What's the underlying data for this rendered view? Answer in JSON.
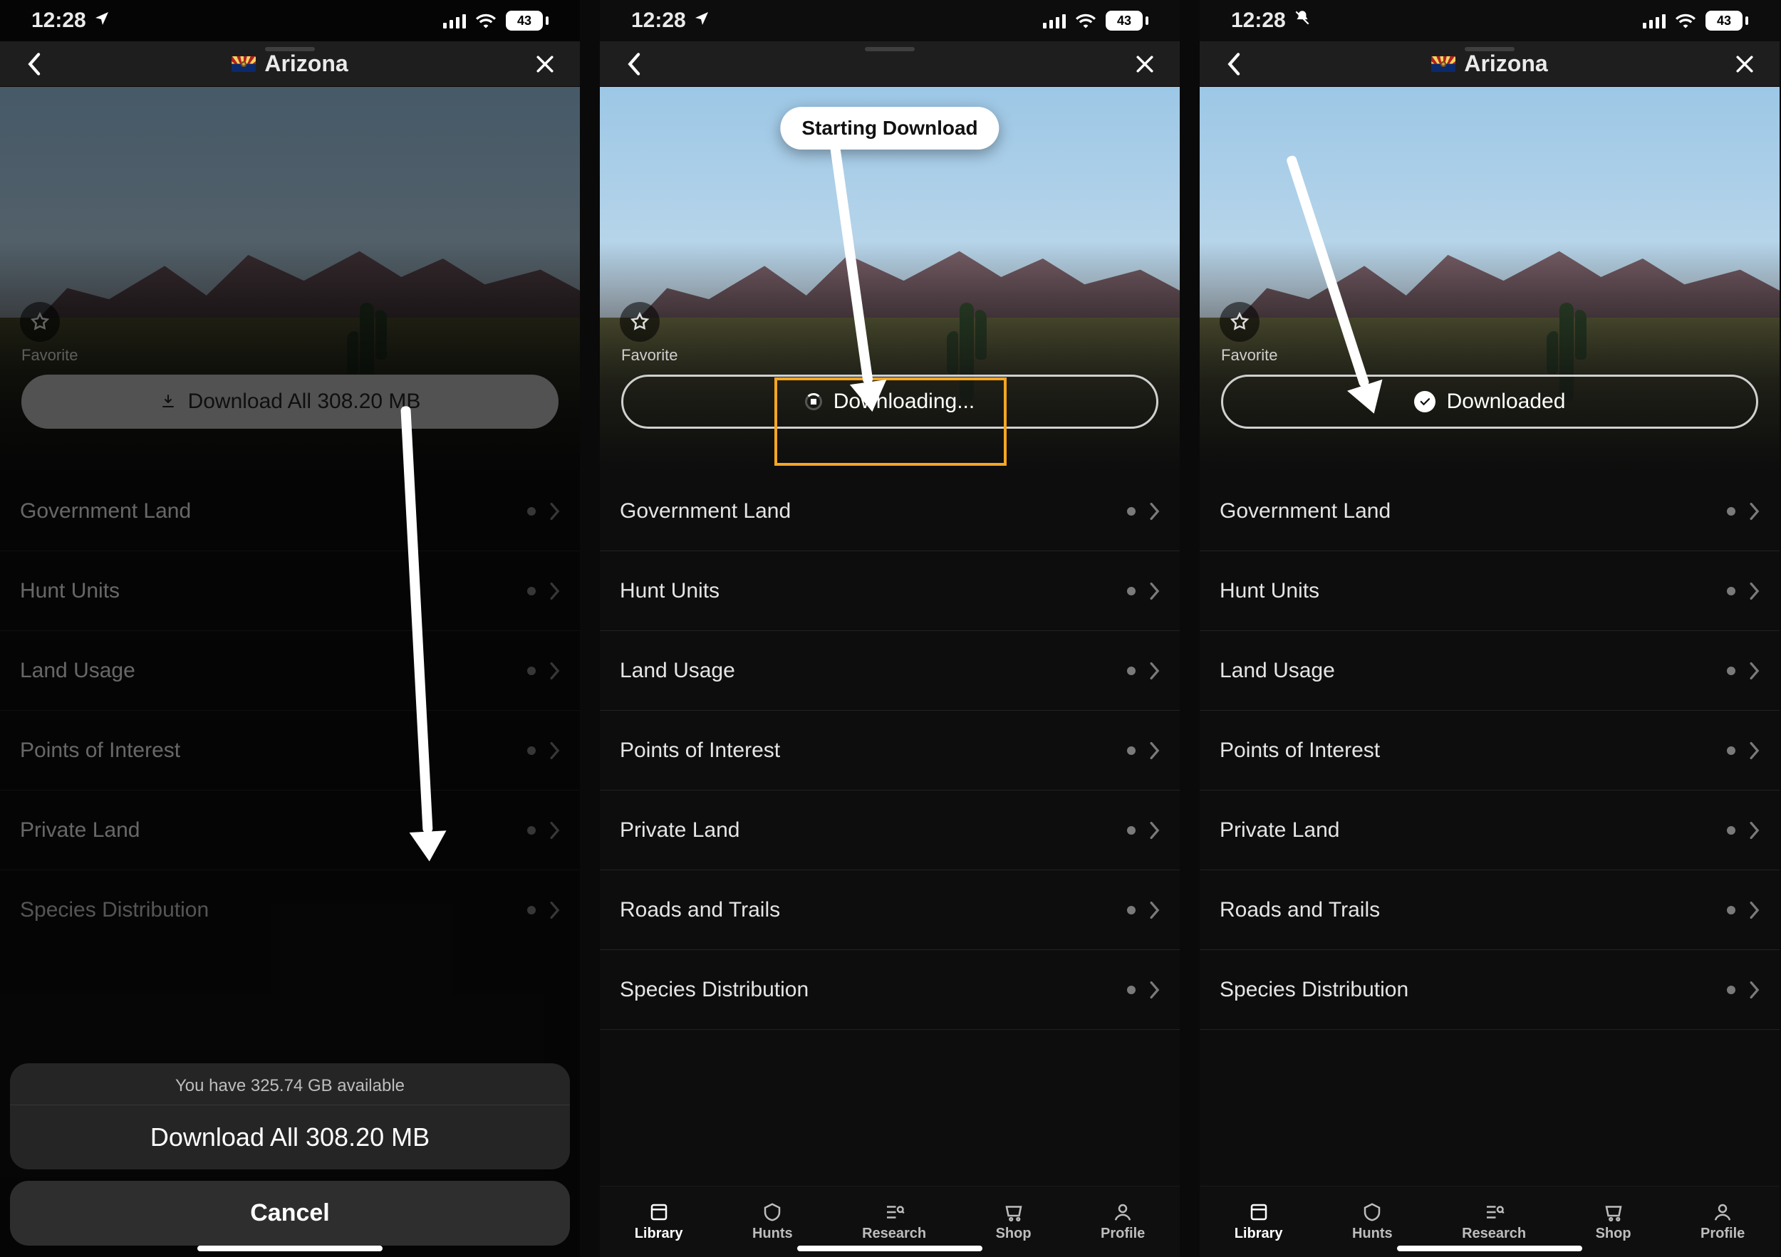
{
  "status": {
    "time": "12:28",
    "battery": "43"
  },
  "header": {
    "title": "Arizona"
  },
  "favorite": "Favorite",
  "layers": [
    "Government Land",
    "Hunt Units",
    "Land Usage",
    "Points of Interest",
    "Private Land",
    "Roads and Trails",
    "Species Distribution"
  ],
  "screen1": {
    "pill": "Download All 308.20 MB",
    "sheet_info": "You have 325.74 GB available",
    "sheet_action": "Download All 308.20 MB",
    "cancel": "Cancel"
  },
  "screen2": {
    "toast": "Starting Download",
    "pill": "Downloading..."
  },
  "screen3": {
    "pill": "Downloaded"
  },
  "tabs": {
    "library": "Library",
    "hunts": "Hunts",
    "research": "Research",
    "shop": "Shop",
    "profile": "Profile"
  }
}
